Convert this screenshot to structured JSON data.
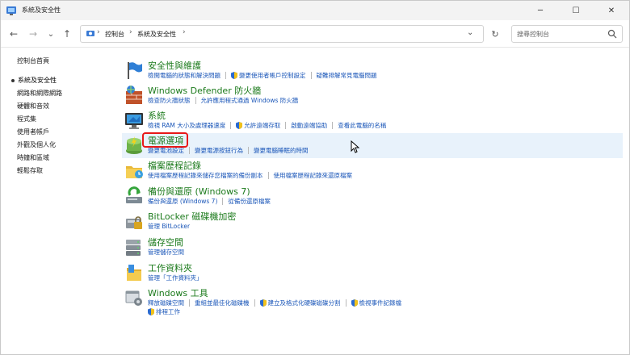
{
  "window": {
    "title": "系統及安全性",
    "controls": {
      "minimize": "─",
      "maximize": "☐",
      "close": "✕"
    }
  },
  "nav": {
    "back": "←",
    "forward": "→",
    "recent": "⌄",
    "up": "↑",
    "breadcrumb": [
      "控制台",
      "系統及安全性"
    ],
    "separator": "›",
    "dropdown": "⌄",
    "refresh": "↻",
    "search_placeholder": "搜尋控制台"
  },
  "sidebar": {
    "home": "控制台首頁",
    "items": [
      {
        "label": "系統及安全性",
        "current": true
      },
      {
        "label": "網路和網際網路"
      },
      {
        "label": "硬體和音效"
      },
      {
        "label": "程式集"
      },
      {
        "label": "使用者帳戶"
      },
      {
        "label": "外觀及個人化"
      },
      {
        "label": "時鐘和區域"
      },
      {
        "label": "輕鬆存取"
      }
    ]
  },
  "categories": [
    {
      "title": "安全性與維護",
      "icon": "flag-icon",
      "links": [
        "檢閱電腦的狀態和解決問題",
        "變更使用者帳戶控制設定",
        "疑難排解常見電腦問題"
      ],
      "shield_links": [
        1
      ]
    },
    {
      "title": "Windows Defender 防火牆",
      "icon": "firewall-icon",
      "links": [
        "檢查防火牆狀態",
        "允許應用程式通過 Windows 防火牆"
      ],
      "shield_links": []
    },
    {
      "title": "系統",
      "icon": "monitor-icon",
      "links": [
        "檢視 RAM 大小及處理器速度",
        "允許遠端存取",
        "啟動遠端協助",
        "查看此電腦的名稱"
      ],
      "shield_links": [
        1
      ]
    },
    {
      "title": "電源選項",
      "icon": "power-icon",
      "links": [
        "變更電池設定",
        "變更電源按鈕行為",
        "變更電腦睡眠的時間"
      ],
      "shield_links": []
    },
    {
      "title": "檔案歷程記錄",
      "icon": "file-history-icon",
      "links": [
        "使用檔案歷程記錄來儲存您檔案的備份副本",
        "使用檔案歷程記錄來還原檔案"
      ],
      "shield_links": []
    },
    {
      "title": "備份與還原 (Windows 7)",
      "icon": "backup-icon",
      "links": [
        "備份與還原 (Windows 7)",
        "從備份還原檔案"
      ],
      "shield_links": []
    },
    {
      "title": "BitLocker 磁碟機加密",
      "icon": "bitlocker-icon",
      "links": [
        "管理 BitLocker"
      ],
      "shield_links": []
    },
    {
      "title": "儲存空間",
      "icon": "storage-icon",
      "links": [
        "管理儲存空間"
      ],
      "shield_links": []
    },
    {
      "title": "工作資料夾",
      "icon": "work-folders-icon",
      "links": [
        "管理「工作資料夾」"
      ],
      "shield_links": []
    },
    {
      "title": "Windows 工具",
      "icon": "windows-tools-icon",
      "links": [
        "釋放磁碟空間",
        "重組並最佳化磁碟機",
        "建立及格式化硬碟磁碟分割",
        "檢視事件記錄檔"
      ],
      "shield_links": [
        2,
        3
      ],
      "links_row2": [
        "排程工作"
      ],
      "shield_links_row2": [
        0
      ]
    }
  ],
  "colors": {
    "category_title": "#1b7a1b",
    "link": "#1a56b8",
    "highlight_box": "#e81818",
    "hover_row": "#e8f2fb"
  }
}
